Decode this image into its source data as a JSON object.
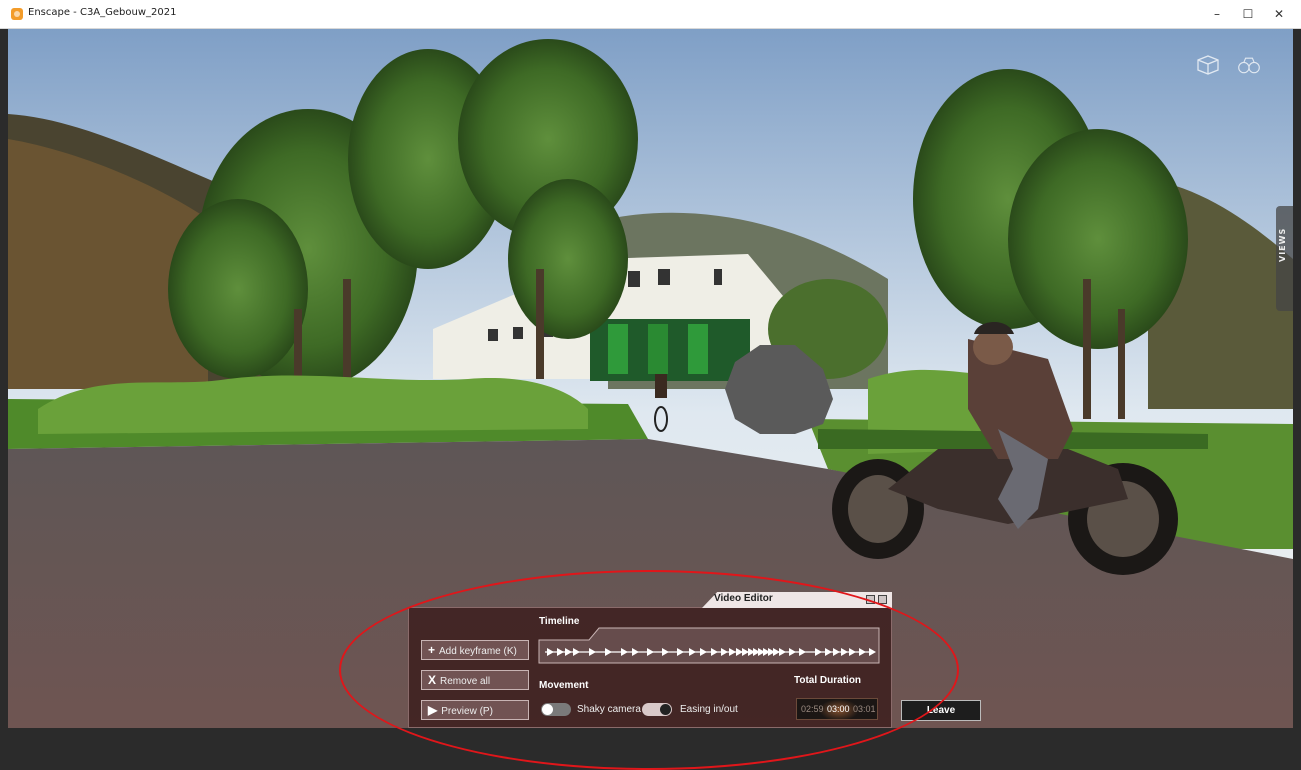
{
  "window": {
    "title": "Enscape - C3A_Gebouw_2021",
    "minimize_glyph": "–",
    "maximize_glyph": "☐",
    "close_glyph": "✕"
  },
  "viewport": {
    "views_tab_label": "VIEWS",
    "icons": [
      "cube-view-icon",
      "binoculars-icon"
    ]
  },
  "video_editor": {
    "title": "Video Editor",
    "timeline_label": "Timeline",
    "buttons": {
      "add_keyframe": {
        "icon": "+",
        "label": "Add keyframe (K)"
      },
      "remove_all": {
        "icon": "X",
        "label": "Remove all"
      },
      "preview": {
        "icon": "▶",
        "label": "Preview (P)"
      }
    },
    "movement_label": "Movement",
    "shaky_camera": {
      "label": "Shaky camera",
      "enabled": false
    },
    "easing": {
      "label": "Easing in/out",
      "enabled": true
    },
    "total_duration_label": "Total Duration",
    "duration_values": [
      "02:59",
      "03:00",
      "03:01"
    ],
    "leave_label": "Leave"
  },
  "colors": {
    "panel": "#3c1e1e",
    "highlight_ellipse": "#e0161a"
  }
}
